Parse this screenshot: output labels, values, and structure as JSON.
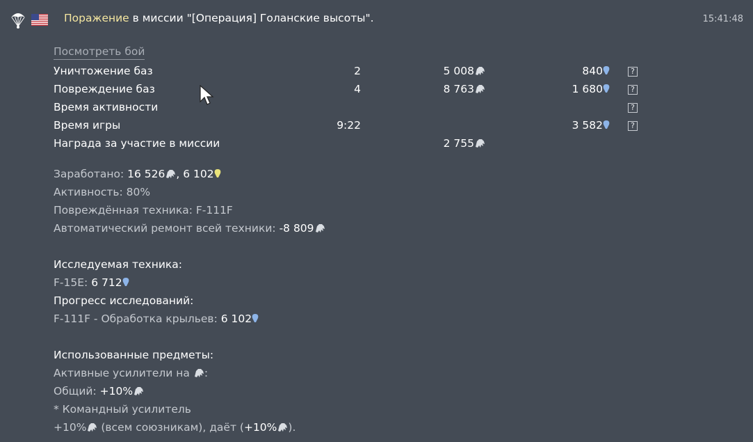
{
  "header": {
    "result_word": "Поражение",
    "mission_text": " в миссии \"[Операция] Голанские высоты\".",
    "time": "15:41:48",
    "left_icons": [
      "parachute-icon",
      "us-flag-icon"
    ]
  },
  "view_fight_label": "Посмотреть бой",
  "rewards_table": {
    "rows": [
      {
        "label": "Уничтожение баз",
        "count": "2",
        "silver": "5 008",
        "research": "840",
        "has_help": true
      },
      {
        "label": "Повреждение баз",
        "count": "4",
        "silver": "8 763",
        "research": "1 680",
        "has_help": true
      },
      {
        "label": "Время активности",
        "count": "",
        "silver": "",
        "research": "",
        "has_help": true
      },
      {
        "label": "Время игры",
        "count": "9:22",
        "silver": "",
        "research": "3 582",
        "has_help": true
      },
      {
        "label": "Награда за участие в миссии",
        "count": "",
        "silver": "2 755",
        "research": "",
        "has_help": false
      }
    ],
    "help_glyph": "?"
  },
  "summary": {
    "earned_label": "Заработано: ",
    "earned_silver": "16 526",
    "earned_sep": ", ",
    "earned_research": "6 102",
    "activity": "Активность: 80%",
    "damaged_label": "Повреждённая техника: ",
    "damaged_value": "F-111F",
    "repair_label": "Автоматический ремонт всей техники: ",
    "repair_value": "-8 809"
  },
  "research": {
    "researched_header": "Исследуемая техника:",
    "vehicle_label": "F-15E: ",
    "vehicle_value": "6 712",
    "progress_header": "Прогресс исследований:",
    "progress_label": "F-111F - Обработка крыльев: ",
    "progress_value": "6 102"
  },
  "items": {
    "header": "Использованные предметы:",
    "active_boosters": "Активные усилители на ",
    "active_boosters_end": ":",
    "general_label": "Общий: ",
    "general_value": "+10%",
    "command_booster": "* Командный усилитель",
    "command_value": "+10%",
    "command_mid": " (всем союзникам), даёт (",
    "command_value2": "+10%",
    "command_end": ")."
  },
  "colors": {
    "background": "#444b55",
    "defeat": "#f4e6a0",
    "research_blue": "#8db4e8",
    "silver": "#d9dde2",
    "gold_yellow": "#e8e27a"
  }
}
